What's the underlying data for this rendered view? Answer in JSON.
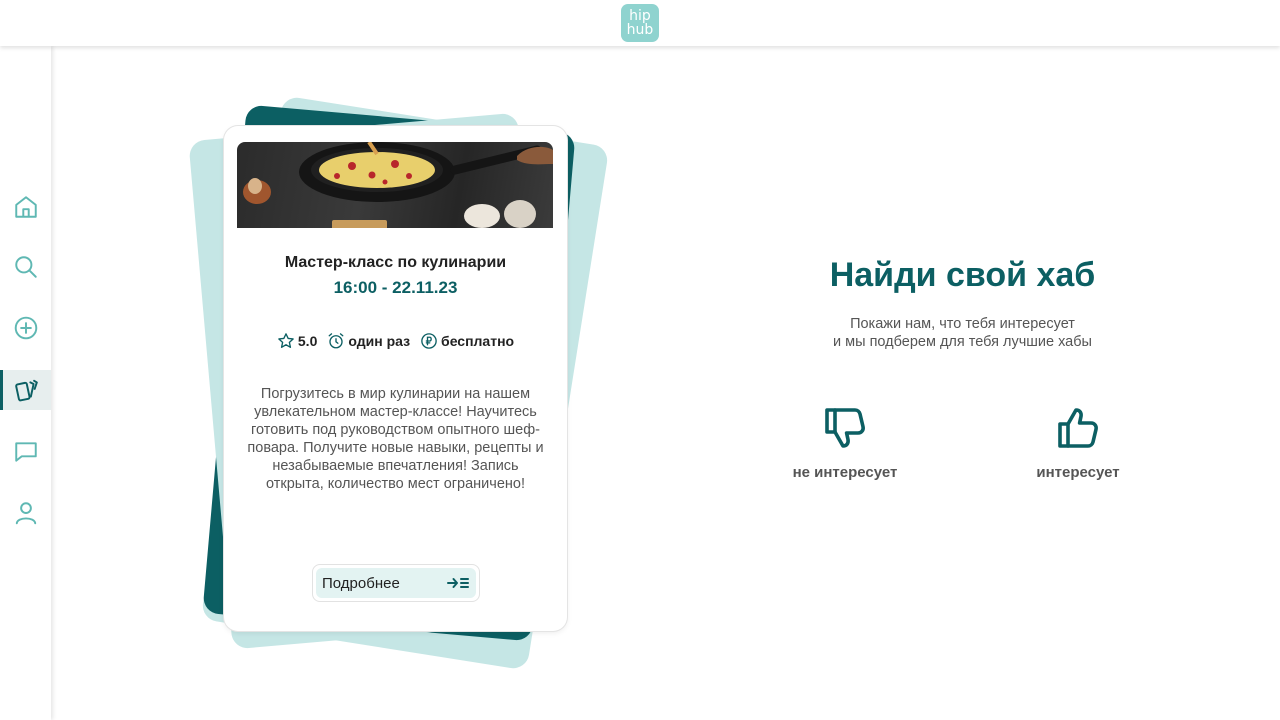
{
  "header": {
    "logo_line1": "hip",
    "logo_line2": "hub"
  },
  "colors": {
    "accent": "#0c5f63",
    "accent_light": "#c5e6e5",
    "logo_bg": "#8fd3cf",
    "icon_light": "#5fb8b3"
  },
  "sidebar": {
    "items": [
      {
        "icon": "home-icon",
        "active": false
      },
      {
        "icon": "search-icon",
        "active": false
      },
      {
        "icon": "add-circle-icon",
        "active": false
      },
      {
        "icon": "cards-icon",
        "active": true
      },
      {
        "icon": "chat-icon",
        "active": false
      },
      {
        "icon": "profile-icon",
        "active": false
      }
    ]
  },
  "card": {
    "title": "Мастер-класс по кулинарии",
    "datetime": "16:00 - 22.11.23",
    "rating": "5.0",
    "frequency": "один раз",
    "price": "бесплатно",
    "description": "Погрузитесь в мир кулинарии на нашем увлекательном мастер-классе! Научитесь готовить под руководством опытного шеф-повара. Получите новые навыки, рецепты и незабываемые впечатления! Запись открыта, количество мест ограничено!",
    "more_label": "Подробнее"
  },
  "hero": {
    "title": "Найди свой хаб",
    "subtitle_line1": "Покажи нам, что тебя интересует",
    "subtitle_line2": "и мы подберем для тебя лучшие хабы"
  },
  "vote": {
    "dislike_label": "не интересует",
    "like_label": "интересует"
  }
}
